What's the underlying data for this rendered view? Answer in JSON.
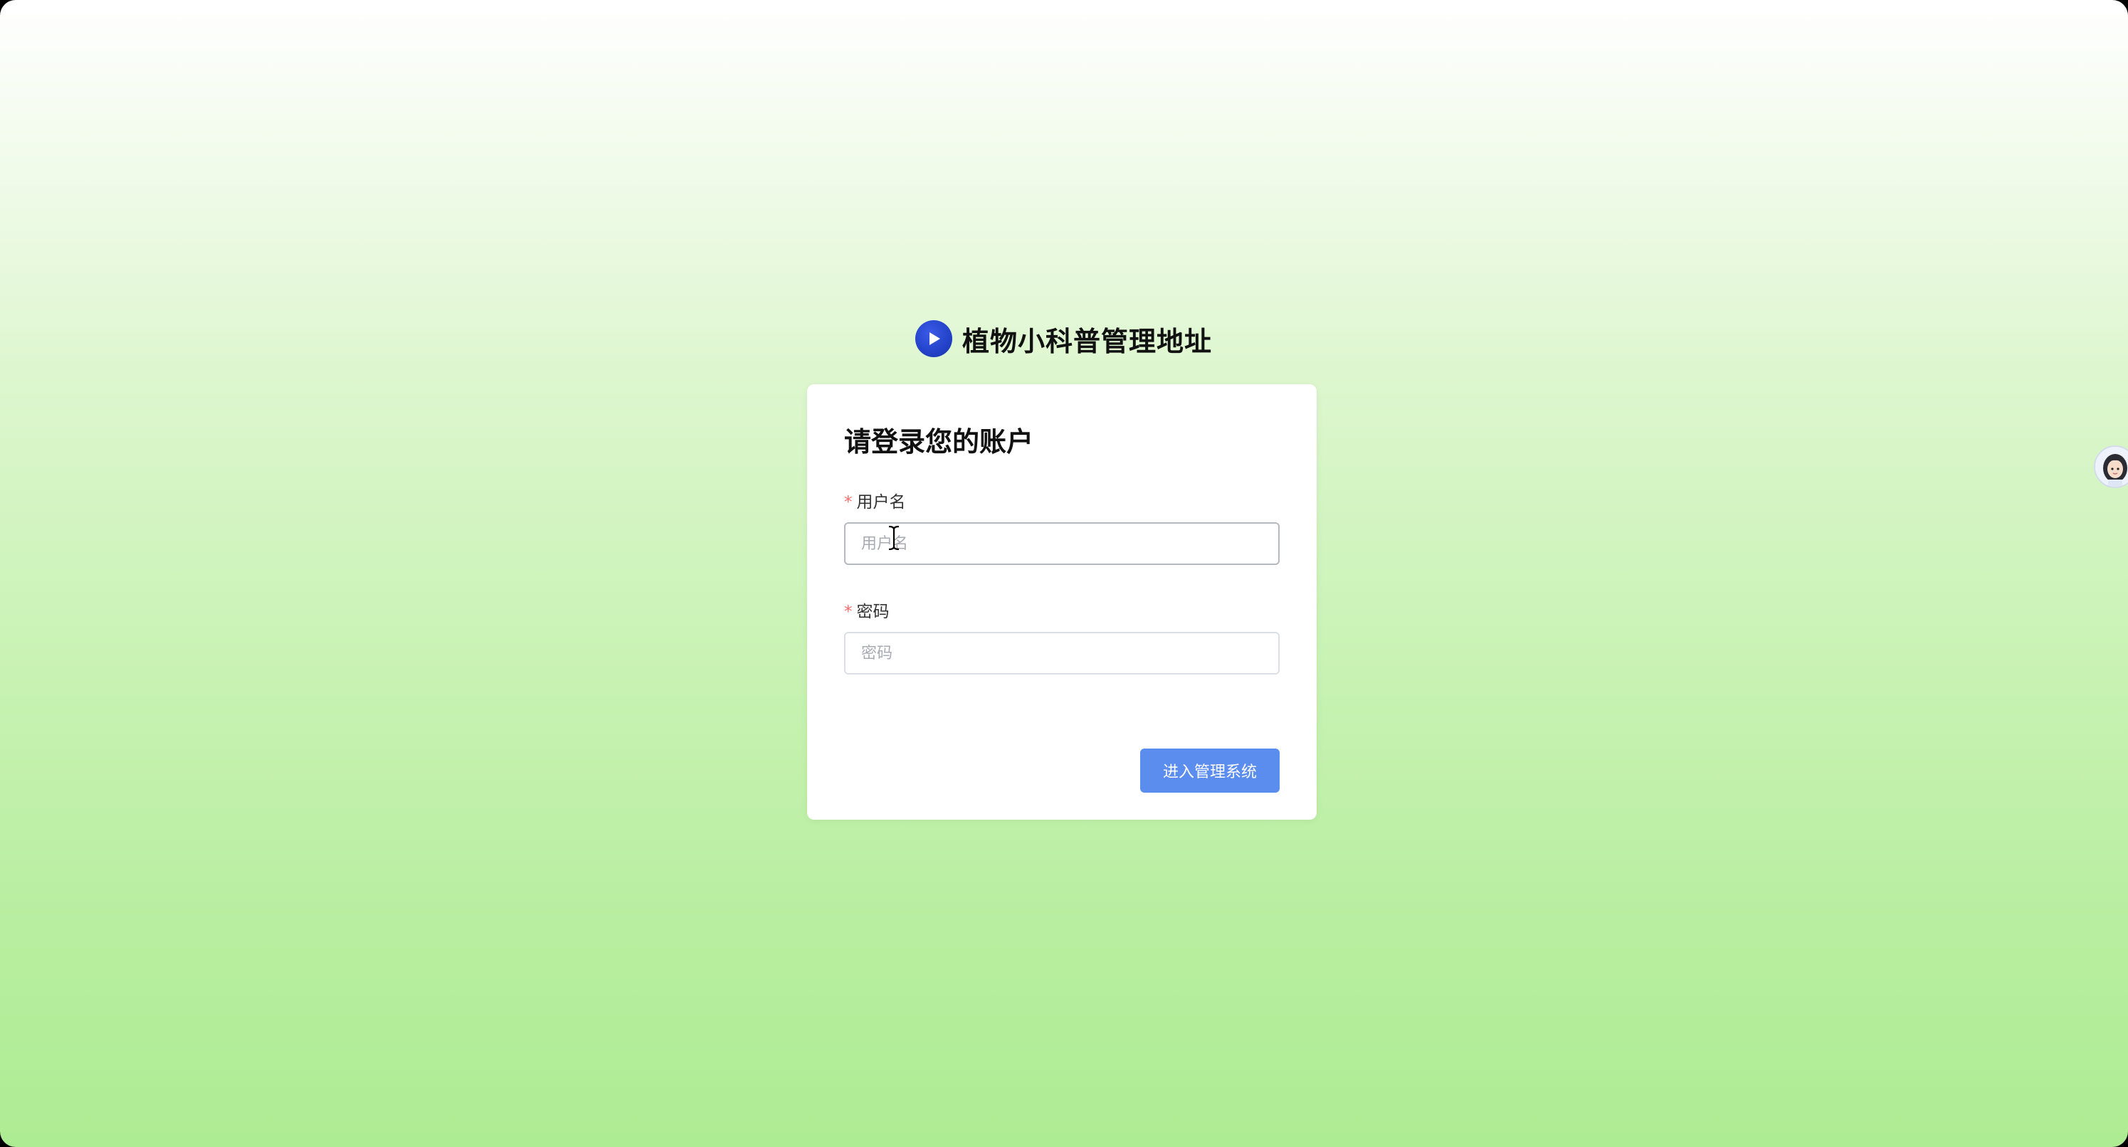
{
  "app": {
    "brand_title": "植物小科普管理地址",
    "logo_icon": "play-circle-icon",
    "accent_color": "#5b8def",
    "logo_color": "#2342c8"
  },
  "login": {
    "title": "请登录您的账户",
    "username": {
      "required_mark": "*",
      "label": "用户名",
      "placeholder": "用户名",
      "value": ""
    },
    "password": {
      "required_mark": "*",
      "label": "密码",
      "placeholder": "密码",
      "value": ""
    },
    "submit_label": "进入管理系统"
  },
  "floating": {
    "assistant_icon": "avatar-icon"
  }
}
